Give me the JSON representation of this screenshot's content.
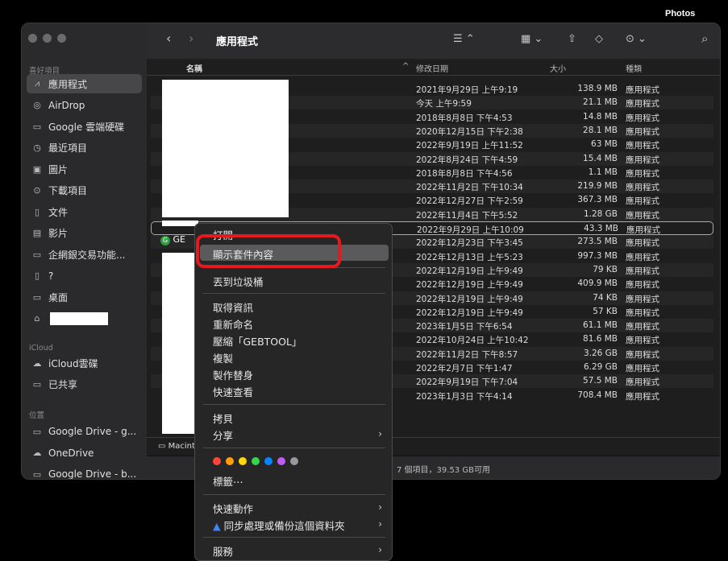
{
  "app_label": "Photos",
  "toolbar": {
    "title": "應用程式",
    "back": "‹",
    "forward": "›",
    "list_view": "☰ ⌃",
    "gallery": "▦ ⌄",
    "more": "⊙ ⌄",
    "search": "⌕"
  },
  "sidebar": {
    "favorites_header": "喜好項目",
    "items": [
      {
        "icon": "⩘",
        "label": "應用程式"
      },
      {
        "icon": "◎",
        "label": "AirDrop"
      },
      {
        "icon": "▭",
        "label": "Google 雲端硬碟"
      },
      {
        "icon": "◷",
        "label": "最近項目"
      },
      {
        "icon": "▣",
        "label": "圖片"
      },
      {
        "icon": "⊙",
        "label": "下載項目"
      },
      {
        "icon": "▯",
        "label": "文件"
      },
      {
        "icon": "▤",
        "label": "影片"
      },
      {
        "icon": "▭",
        "label": "企網銀交易功能..."
      },
      {
        "icon": "▯",
        "label": "?"
      },
      {
        "icon": "▭",
        "label": "桌面"
      },
      {
        "icon": "⌂",
        "label": ""
      }
    ],
    "icloud_header": "iCloud",
    "icloud_items": [
      {
        "icon": "☁",
        "label": "iCloud雲碟"
      },
      {
        "icon": "▭",
        "label": "已共享"
      }
    ],
    "locations_header": "位置",
    "location_items": [
      {
        "icon": "▭",
        "label": "Google Drive - g..."
      },
      {
        "icon": "☁",
        "label": "OneDrive"
      },
      {
        "icon": "▭",
        "label": "Google Drive - b..."
      }
    ]
  },
  "columns": {
    "name": "名稱",
    "date": "修改日期",
    "size": "大小",
    "kind": "種類"
  },
  "rows": [
    {
      "date": "2021年9月29日 上午9:19",
      "size": "138.9 MB",
      "kind": "應用程式"
    },
    {
      "date": "今天 上午9:59",
      "size": "21.1 MB",
      "kind": "應用程式"
    },
    {
      "date": "2018年8月8日 下午4:53",
      "size": "14.8 MB",
      "kind": "應用程式"
    },
    {
      "date": "2020年12月15日 下午2:38",
      "size": "28.1 MB",
      "kind": "應用程式"
    },
    {
      "date": "2022年9月19日 上午11:52",
      "size": "63 MB",
      "kind": "應用程式"
    },
    {
      "date": "2022年8月24日 下午4:59",
      "size": "15.4 MB",
      "kind": "應用程式"
    },
    {
      "date": "2018年8月8日 下午4:56",
      "size": "1.1 MB",
      "kind": "應用程式"
    },
    {
      "date": "2022年11月2日 下午10:34",
      "size": "219.9 MB",
      "kind": "應用程式"
    },
    {
      "date": "2022年12月27日 下午2:59",
      "size": "367.3 MB",
      "kind": "應用程式"
    },
    {
      "date": "2022年11月4日 下午5:52",
      "size": "1.28 GB",
      "kind": "應用程式"
    },
    {
      "date": "2022年9月29日 上午10:09",
      "size": "43.3 MB",
      "kind": "應用程式"
    },
    {
      "date": "2022年12月23日 下午3:45",
      "size": "273.5 MB",
      "kind": "應用程式"
    },
    {
      "date": "2022年12月13日 上午5:23",
      "size": "997.3 MB",
      "kind": "應用程式"
    },
    {
      "date": "2022年12月19日 上午9:49",
      "size": "79 KB",
      "kind": "應用程式"
    },
    {
      "date": "2022年12月19日 上午9:49",
      "size": "409.9 MB",
      "kind": "應用程式"
    },
    {
      "date": "2022年12月19日 上午9:49",
      "size": "74 KB",
      "kind": "應用程式"
    },
    {
      "date": "2022年12月19日 上午9:49",
      "size": "57 KB",
      "kind": "應用程式"
    },
    {
      "date": "2023年1月5日 下午6:54",
      "size": "61.1 MB",
      "kind": "應用程式"
    },
    {
      "date": "2022年10月24日 上午10:42",
      "size": "81.6 MB",
      "kind": "應用程式"
    },
    {
      "date": "2022年11月2日 下午8:57",
      "size": "3.26 GB",
      "kind": "應用程式"
    },
    {
      "date": "2022年2月7日 下午1:47",
      "size": "6.29 GB",
      "kind": "應用程式"
    },
    {
      "date": "2022年9月19日 下午7:04",
      "size": "57.5 MB",
      "kind": "應用程式"
    },
    {
      "date": "2023年1月3日 下午4:14",
      "size": "708.4 MB",
      "kind": "應用程式"
    }
  ],
  "selected_row_name": "GE",
  "pathbar": "Macinto",
  "status": "7 個項目，39.53 GB可用",
  "context_menu": {
    "open": "打開",
    "show_package": "顯示套件內容",
    "trash": "丟到垃圾桶",
    "get_info": "取得資訊",
    "rename": "重新命名",
    "compress": "壓縮「GEBTOOL」",
    "duplicate": "複製",
    "alias": "製作替身",
    "quicklook": "快速查看",
    "copy": "拷貝",
    "share": "分享",
    "tags": "標籤⋯",
    "quick_actions": "快速動作",
    "sync": "同步處理或備份這個資料夾",
    "services": "服務",
    "tag_colors": [
      "#ff453a",
      "#ff9f0a",
      "#ffd60a",
      "#32d74b",
      "#0a84ff",
      "#bf5af2",
      "#98989d"
    ]
  },
  "highlight_color": "#e8191d"
}
